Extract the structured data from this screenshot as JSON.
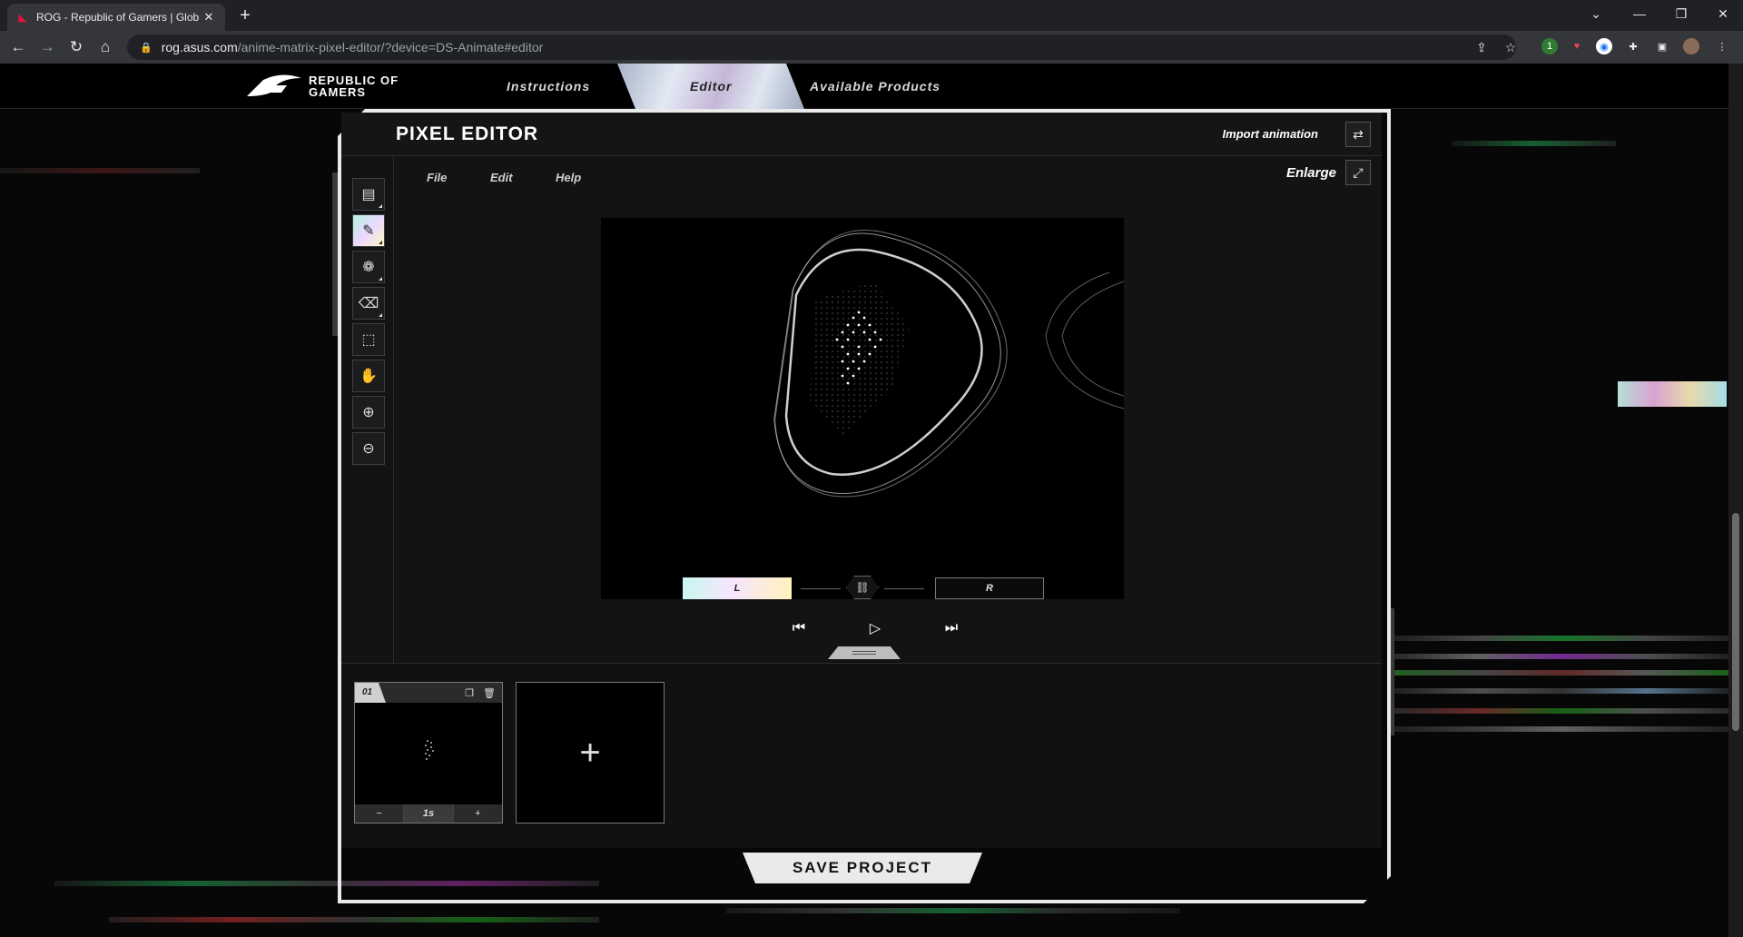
{
  "browser": {
    "tab_title": "ROG - Republic of Gamers | Glob",
    "url_host": "rog.asus.com",
    "url_path": "/anime-matrix-pixel-editor/?device=DS-Animate#editor",
    "extension_badge": "1"
  },
  "site": {
    "logo_line1": "REPUBLIC OF",
    "logo_line2": "GAMERS",
    "nav": [
      {
        "label": "Instructions"
      },
      {
        "label": "Editor"
      },
      {
        "label": "Available Products"
      }
    ],
    "active_nav": "Editor"
  },
  "editor": {
    "title": "PIXEL EDITOR",
    "import_label": "Import animation",
    "menu": [
      "File",
      "Edit",
      "Help"
    ],
    "enlarge_label": "Enlarge",
    "tools": [
      {
        "icon": "background-image-icon"
      },
      {
        "icon": "pencil-icon",
        "active": true
      },
      {
        "icon": "color-palette-icon"
      },
      {
        "icon": "eraser-icon"
      },
      {
        "icon": "selection-icon"
      },
      {
        "icon": "hand-icon"
      },
      {
        "icon": "zoom-in-icon"
      },
      {
        "icon": "zoom-out-icon"
      }
    ],
    "preview_icon": "eye-icon",
    "left_label": "L",
    "right_label": "R"
  },
  "timeline": {
    "frames": [
      {
        "number": "01",
        "duration": "1s",
        "minus": "−",
        "plus": "+"
      }
    ],
    "add_frame_symbol": "+"
  },
  "save_label": "SAVE PROJECT",
  "colors": {
    "accent_gradient": [
      "#c9f7ef",
      "#f7e5ff",
      "#fff2bd"
    ],
    "rog_red": "#e0143c"
  }
}
